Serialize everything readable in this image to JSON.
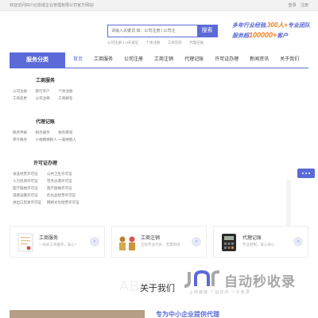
{
  "topbar": {
    "welcome": "欢迎访问四川记逐成企业管理有限公司官方网站!",
    "login": "登录",
    "register": "注册"
  },
  "search": {
    "placeholder": "请输入关键词 如：公司注册 | 公司注",
    "button": "搜索",
    "hotwords": [
      "公司注册 1-3天拿证",
      "个体注册",
      "工商年检",
      "代理记账"
    ]
  },
  "promo": {
    "line1_prefix": "多年行业经验,",
    "line1_num": "300人+",
    "line1_suffix": "专业团队",
    "line2_prefix": "服务超",
    "line2_num": "100000+",
    "line2_suffix": "客户"
  },
  "nav": {
    "category_label": "服务分类",
    "items": [
      "首页",
      "工商服务",
      "公司注册",
      "工商注销",
      "代理记账",
      "许可证办理",
      "新闻资讯",
      "关于我们"
    ]
  },
  "categories": [
    {
      "title": "工商服务",
      "items": [
        "公司注册",
        "银行开户",
        "个体注册",
        "工商变更",
        "公司注销",
        "工商解名"
      ]
    },
    {
      "title": "代理记账",
      "items": [
        "税务申报",
        "税务服务",
        "税务筹划",
        "审计报务",
        "小规模纳税人",
        "一般纳税人"
      ]
    },
    {
      "title": "许可证办理",
      "items": [
        "食品经营许可证",
        "公共卫生许可证",
        "人力资源许可证",
        "劳务派遣许可证",
        "医疗器械许可证",
        "医疗器械许可证",
        "道路运输许可证",
        "危化品经营许可证",
        "进出口贸易许可证",
        "网络文化经营许可证"
      ]
    }
  ],
  "cards": [
    {
      "title": "工商服务",
      "desc": "一站式工商服务，安心！"
    },
    {
      "title": "工商注销",
      "desc": "全程专业代办，无需到场"
    },
    {
      "title": "代理记账",
      "desc": "专业财税，安心省心"
    }
  ],
  "about": {
    "bg": "ABOUT",
    "title": "关于我们",
    "headline": "专为中小企业提供代理"
  },
  "watermark": {
    "text": "自动秒收录",
    "slogan": "上线链接 一站访问 一次收录"
  },
  "colors": {
    "accent": "#5b6ad8",
    "highlight": "#f07d1a"
  }
}
